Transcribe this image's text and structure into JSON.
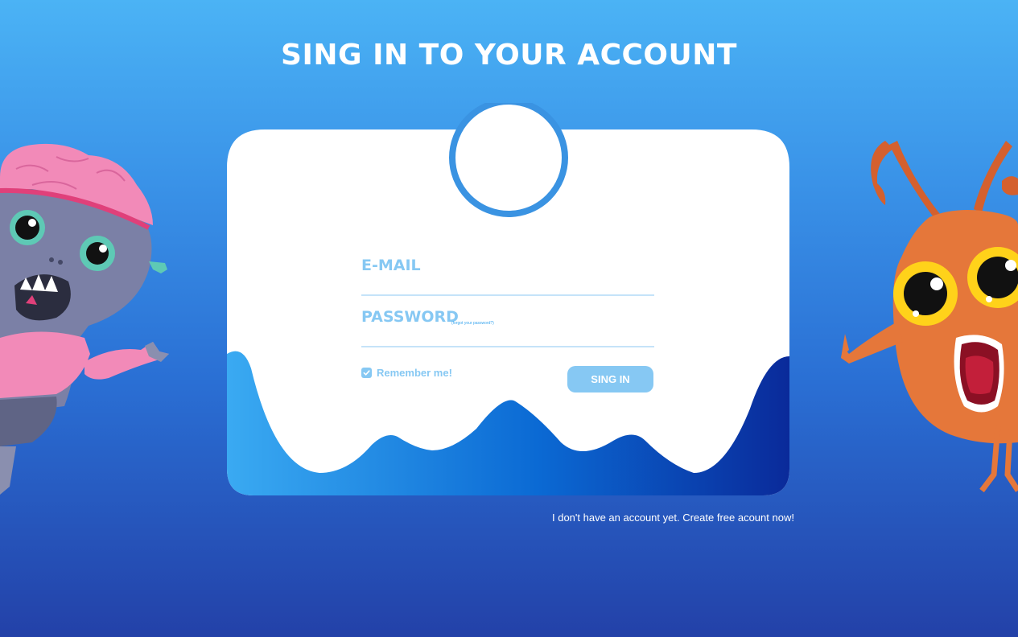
{
  "page": {
    "title": "SING IN TO YOUR ACCOUNT",
    "background_top": "#4bb3f5",
    "background_bottom": "#2341a8"
  },
  "form": {
    "email_label": "E-MAIL",
    "password_label": "PASSWORD",
    "forgot_password_text": "(forgot your password?)",
    "remember_label": "Remember me!",
    "remember_checked": true,
    "signin_label": "SING IN",
    "accent_color": "#86c8f3"
  },
  "footer": {
    "create_account_text": "I don't have an account yet. Create free acount now!"
  },
  "illustrations": {
    "left": "zombie-monster",
    "right": "orange-bug-monster"
  }
}
